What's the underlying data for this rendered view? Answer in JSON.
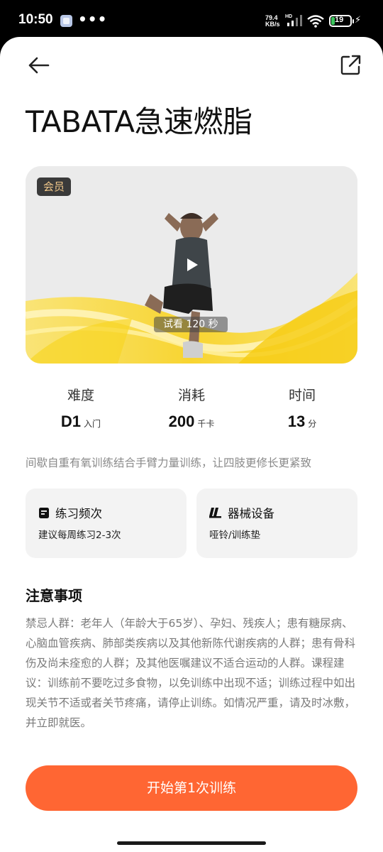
{
  "status_bar": {
    "time": "10:50",
    "more_dots": "•••",
    "speed_value": "79.4",
    "speed_unit": "KB/s",
    "hd": "HD",
    "battery": "19"
  },
  "header": {
    "back_icon": "arrow-left-icon",
    "share_icon": "share-external-icon"
  },
  "course": {
    "title": "TABATA急速燃脂",
    "video": {
      "badge": "会员",
      "trial": "试看 120 秒",
      "play_icon": "play-icon",
      "accent": "#f7d21e"
    },
    "stats": [
      {
        "label": "难度",
        "value": "D1",
        "unit": "入门"
      },
      {
        "label": "消耗",
        "value": "200",
        "unit": "千卡"
      },
      {
        "label": "时间",
        "value": "13",
        "unit": "分"
      }
    ],
    "description": "间歇自重有氧训练结合手臂力量训练，让四肢更修长更紧致",
    "cards": [
      {
        "icon": "calendar-icon",
        "title": "练习频次",
        "body": "建议每周练习2-3次"
      },
      {
        "icon": "dumbbell-equipment-icon",
        "title": "器械设备",
        "body": "哑铃/训练垫"
      }
    ],
    "notice": {
      "title": "注意事项",
      "body": "禁忌人群：老年人（年龄大于65岁）、孕妇、残疾人；患有糖尿病、心脑血管疾病、肺部类疾病以及其他新陈代谢疾病的人群；患有骨科伤及尚未痊愈的人群；及其他医嘱建议不适合运动的人群。课程建议：训练前不要吃过多食物，以免训练中出现不适；训练过程中如出现关节不适或者关节疼痛，请停止训练。如情况严重，请及时冰敷，并立即就医。"
    },
    "start_button": "开始第1次训练",
    "start_color": "#ff6633"
  }
}
